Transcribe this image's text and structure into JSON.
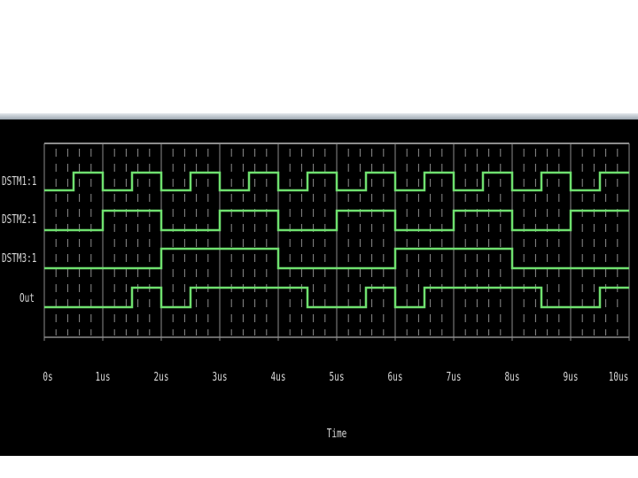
{
  "waveform": {
    "signals": [
      {
        "name": "DSTM1:1",
        "values": [
          0,
          1,
          0,
          1,
          0,
          1,
          0,
          1,
          0,
          1,
          0,
          1,
          0,
          1,
          0,
          1,
          0,
          1,
          0,
          1
        ]
      },
      {
        "name": "DSTM2:1",
        "values": [
          0,
          0,
          1,
          1,
          0,
          0,
          1,
          1,
          0,
          0,
          1,
          1,
          0,
          0,
          1,
          1,
          0,
          0,
          1,
          1
        ]
      },
      {
        "name": "DSTM3:1",
        "values": [
          0,
          0,
          0,
          0,
          1,
          1,
          1,
          1,
          0,
          0,
          0,
          0,
          1,
          1,
          1,
          1,
          0,
          0,
          0,
          0
        ]
      },
      {
        "name": "Out",
        "values": [
          0,
          0,
          0,
          1,
          0,
          1,
          1,
          1,
          1,
          0,
          0,
          1,
          0,
          1,
          1,
          1,
          1,
          0,
          0,
          1
        ]
      }
    ],
    "time_ticks": [
      "0s",
      "1us",
      "2us",
      "3us",
      "4us",
      "5us",
      "6us",
      "7us",
      "8us",
      "9us",
      "10us"
    ],
    "axis_title": "Time",
    "time_range_us": [
      0,
      10
    ],
    "step_us": 0.5,
    "colors": {
      "background": "#000000",
      "trace": "#6fe06f",
      "grid": "#8c8c8c",
      "text": "#d9d9d9"
    }
  }
}
